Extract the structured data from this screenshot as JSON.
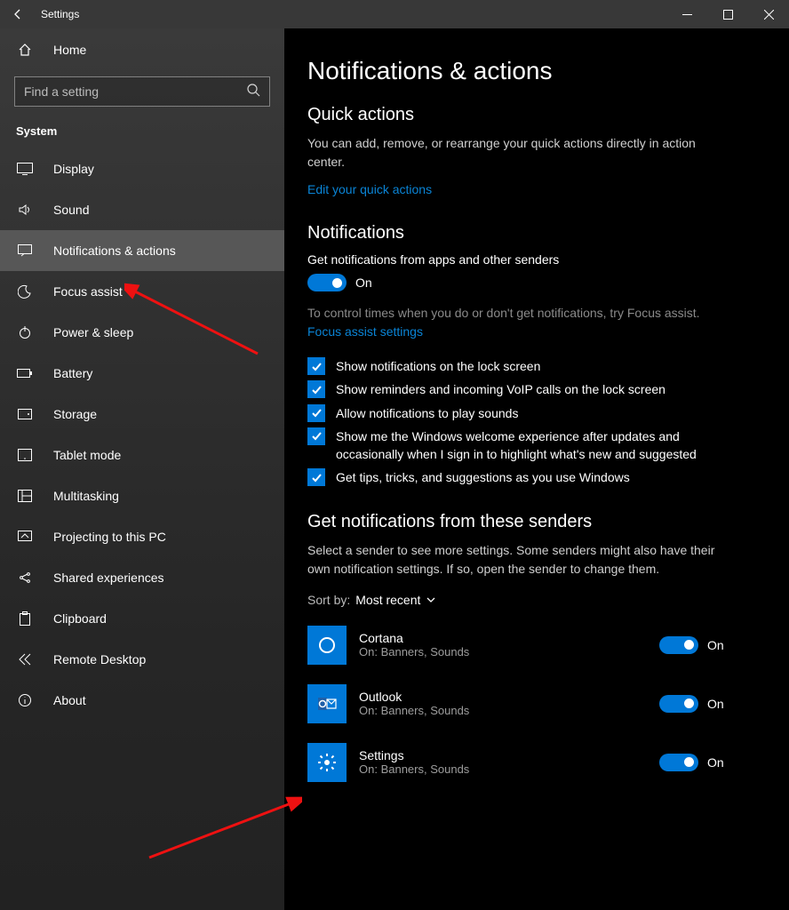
{
  "titlebar": {
    "title": "Settings"
  },
  "sidebar": {
    "home": "Home",
    "search_placeholder": "Find a setting",
    "section": "System",
    "items": [
      {
        "id": "display",
        "label": "Display"
      },
      {
        "id": "sound",
        "label": "Sound"
      },
      {
        "id": "notifications",
        "label": "Notifications & actions",
        "selected": true
      },
      {
        "id": "focus-assist",
        "label": "Focus assist"
      },
      {
        "id": "power-sleep",
        "label": "Power & sleep"
      },
      {
        "id": "battery",
        "label": "Battery"
      },
      {
        "id": "storage",
        "label": "Storage"
      },
      {
        "id": "tablet-mode",
        "label": "Tablet mode"
      },
      {
        "id": "multitasking",
        "label": "Multitasking"
      },
      {
        "id": "projecting",
        "label": "Projecting to this PC"
      },
      {
        "id": "shared",
        "label": "Shared experiences"
      },
      {
        "id": "clipboard",
        "label": "Clipboard"
      },
      {
        "id": "remote-desktop",
        "label": "Remote Desktop"
      },
      {
        "id": "about",
        "label": "About"
      }
    ]
  },
  "main": {
    "page_title": "Notifications & actions",
    "quick_actions": {
      "heading": "Quick actions",
      "desc": "You can add, remove, or rearrange your quick actions directly in action center.",
      "link": "Edit your quick actions"
    },
    "notifications": {
      "heading": "Notifications",
      "toggle_label": "Get notifications from apps and other senders",
      "toggle_state": "On",
      "sub_text": "To control times when you do or don't get notifications, try Focus assist.",
      "sub_link": "Focus assist settings",
      "checkboxes": [
        "Show notifications on the lock screen",
        "Show reminders and incoming VoIP calls on the lock screen",
        "Allow notifications to play sounds",
        "Show me the Windows welcome experience after updates and occasionally when I sign in to highlight what's new and suggested",
        "Get tips, tricks, and suggestions as you use Windows"
      ]
    },
    "senders": {
      "heading": "Get notifications from these senders",
      "desc": "Select a sender to see more settings. Some senders might also have their own notification settings. If so, open the sender to change them.",
      "sort_label": "Sort by:",
      "sort_value": "Most recent",
      "list": [
        {
          "name": "Cortana",
          "detail": "On: Banners, Sounds",
          "state": "On"
        },
        {
          "name": "Outlook",
          "detail": "On: Banners, Sounds",
          "state": "On"
        },
        {
          "name": "Settings",
          "detail": "On: Banners, Sounds",
          "state": "On"
        }
      ]
    }
  }
}
